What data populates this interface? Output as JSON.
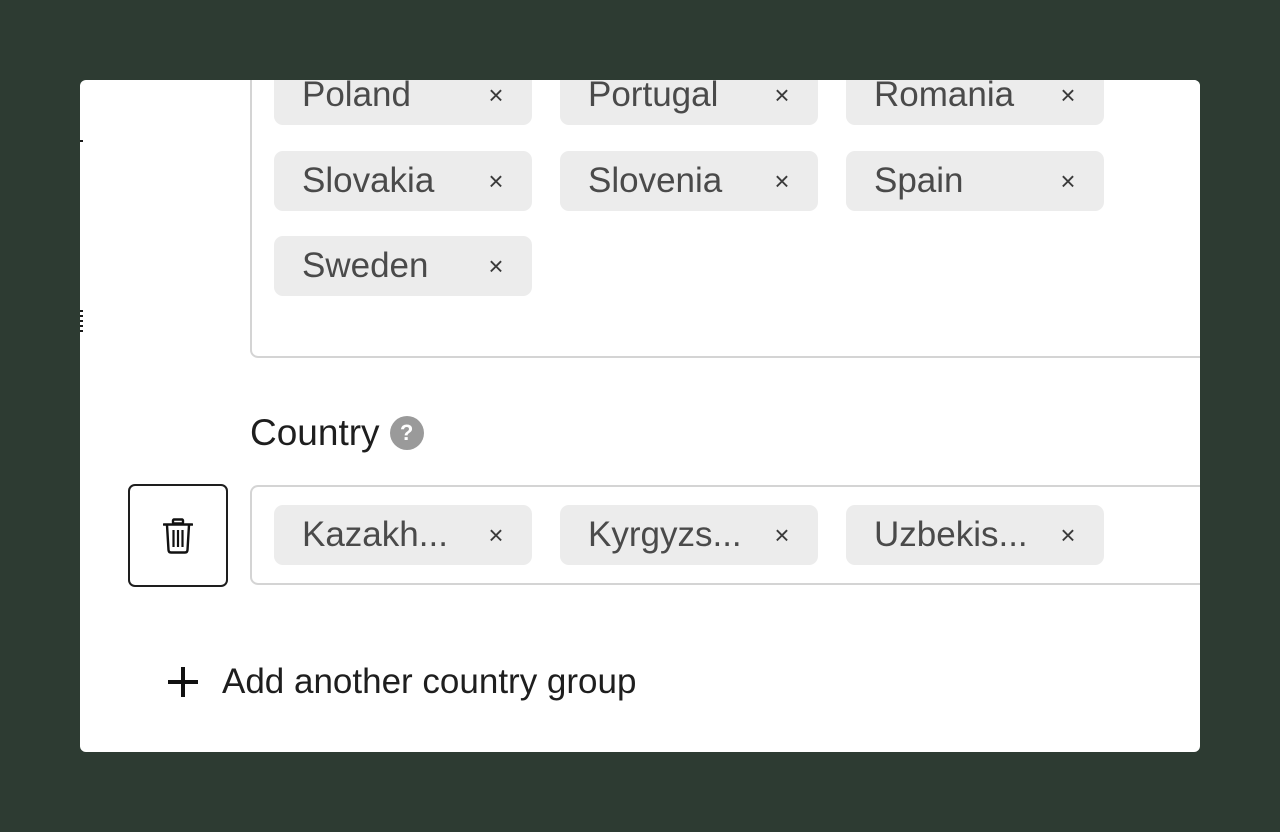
{
  "first_group": {
    "tags": [
      {
        "label": "Poland",
        "close_glyph": "×"
      },
      {
        "label": "Portugal",
        "close_glyph": "×"
      },
      {
        "label": "Romania",
        "close_glyph": "×"
      },
      {
        "label": "Slovakia",
        "close_glyph": "×"
      },
      {
        "label": "Slovenia",
        "close_glyph": "×"
      },
      {
        "label": "Spain",
        "close_glyph": "×"
      },
      {
        "label": "Sweden",
        "close_glyph": "×"
      }
    ]
  },
  "second_group": {
    "label": "Country",
    "help_glyph": "?",
    "delete_icon": "trash-icon",
    "tags": [
      {
        "label": "Kazakh...",
        "close_glyph": "×"
      },
      {
        "label": "Kyrgyzs...",
        "close_glyph": "×"
      },
      {
        "label": "Uzbekis...",
        "close_glyph": "×"
      }
    ]
  },
  "add_group": {
    "icon": "plus-icon",
    "label": "Add another country group"
  },
  "colors": {
    "background": "#2d3b32",
    "card": "#ffffff",
    "tag": "#ececec",
    "help_icon": "#9a9a9a"
  }
}
